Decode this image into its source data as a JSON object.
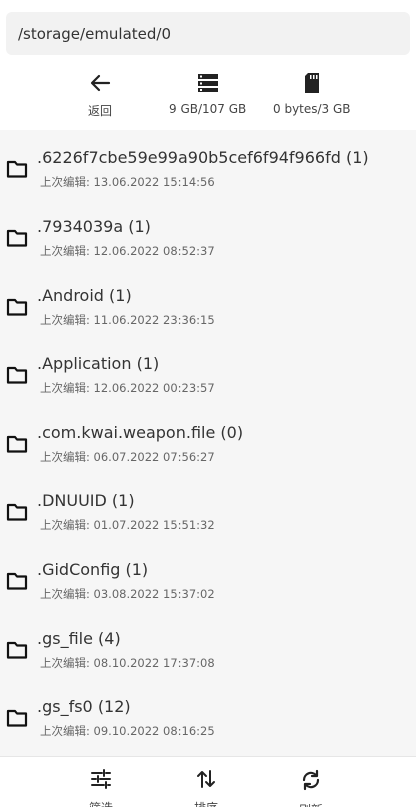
{
  "path": "/storage/emulated/0",
  "toolbar": {
    "back_label": "返回",
    "internal_label": "9 GB/107 GB",
    "sd_label": "0 bytes/3 GB"
  },
  "files": [
    {
      "name": ".6226f7cbe59e99a90b5cef6f94f966fd (1)",
      "modified": "上次编辑: 13.06.2022 15:14:56"
    },
    {
      "name": ".7934039a (1)",
      "modified": "上次编辑: 12.06.2022 08:52:37"
    },
    {
      "name": ".Android (1)",
      "modified": "上次编辑: 11.06.2022 23:36:15"
    },
    {
      "name": ".Application (1)",
      "modified": "上次编辑: 12.06.2022 00:23:57"
    },
    {
      "name": ".com.kwai.weapon.file (0)",
      "modified": "上次编辑: 06.07.2022 07:56:27"
    },
    {
      "name": ".DNUUID (1)",
      "modified": "上次编辑: 01.07.2022 15:51:32"
    },
    {
      "name": ".GidConfig (1)",
      "modified": "上次编辑: 03.08.2022 15:37:02"
    },
    {
      "name": ".gs_file (4)",
      "modified": "上次编辑: 08.10.2022 17:37:08"
    },
    {
      "name": ".gs_fs0 (12)",
      "modified": "上次编辑: 09.10.2022 08:16:25"
    }
  ],
  "bottom": {
    "filter_label": "筛选",
    "sort_label": "排序",
    "refresh_label": "刷新"
  },
  "icons": {
    "back": "arrow-left-icon",
    "internal": "storage-icon",
    "sd": "sd-card-icon",
    "folder": "folder-icon",
    "filter": "tune-icon",
    "sort": "sort-arrows-icon",
    "refresh": "refresh-icon"
  },
  "colors": {
    "icon": "#222222",
    "list_bg": "#f6f6f6",
    "path_bg": "#f2f2f2"
  }
}
